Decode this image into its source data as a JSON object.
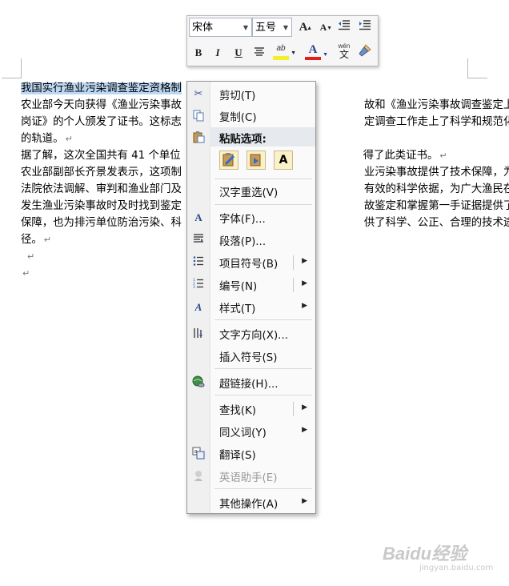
{
  "toolbar": {
    "font_name": "宋体",
    "font_size": "五号",
    "grow_font_label": "A",
    "shrink_font_label": "A",
    "bold_label": "B",
    "italic_label": "I",
    "underline_label": "U",
    "highlight_label": "ab",
    "font_color_label": "A",
    "phonetic_label": "wén",
    "phonetic_char": "文",
    "highlight_color": "#f5ee2a",
    "font_color": "#e0201e"
  },
  "document": {
    "lines": [
      {
        "selected": "我国实行渔业污染调查鉴定资格制",
        "text": ""
      },
      {
        "text_left": "农业部今天向获得《渔业污染事故",
        "text_right": "故和《渔业污染事故调查鉴定上"
      },
      {
        "text_left": "岗证》的个人颁发了证书。这标志",
        "text_right": "定调查工作走上了科学和规范化"
      },
      {
        "text": "的轨道。"
      },
      {
        "text_left": "据了解，这次全国共有 41 个单位",
        "text_right": "得了此类证书。"
      },
      {
        "text_left": "农业部副部长齐景发表示，这项制",
        "text_right": "业污染事故提供了技术保障，为"
      },
      {
        "text_left": "法院依法调解、审判和渔业部门及",
        "text_right": "有效的科学依据，为广大渔民在"
      },
      {
        "text_left": "发生渔业污染事故时及时找到鉴定",
        "text_right": "故鉴定和掌握第一手证据提供了"
      },
      {
        "text_left": "保障，也为排污单位防治污染、科",
        "text_right": "供了科学、公正、合理的技术途"
      },
      {
        "text": "径。"
      },
      {
        "text": ""
      },
      {
        "text": ""
      }
    ],
    "para_mark": "↵"
  },
  "menu": {
    "cut": "剪切(T)",
    "copy": "复制(C)",
    "paste_options": "粘贴选项:",
    "paste_text_only": "A",
    "reconvert": "汉字重选(V)",
    "font": "字体(F)...",
    "paragraph": "段落(P)...",
    "bullets": "项目符号(B)",
    "numbering": "编号(N)",
    "styles": "样式(T)",
    "text_direction": "文字方向(X)...",
    "insert_symbol": "插入符号(S)",
    "hyperlink": "超链接(H)...",
    "find": "查找(K)",
    "synonyms": "同义词(Y)",
    "translate": "翻译(S)",
    "english_assistant": "英语助手(E)",
    "other_actions": "其他操作(A)"
  },
  "watermark": {
    "logo": "Baidu经验",
    "url": "jingyan.baidu.com"
  }
}
